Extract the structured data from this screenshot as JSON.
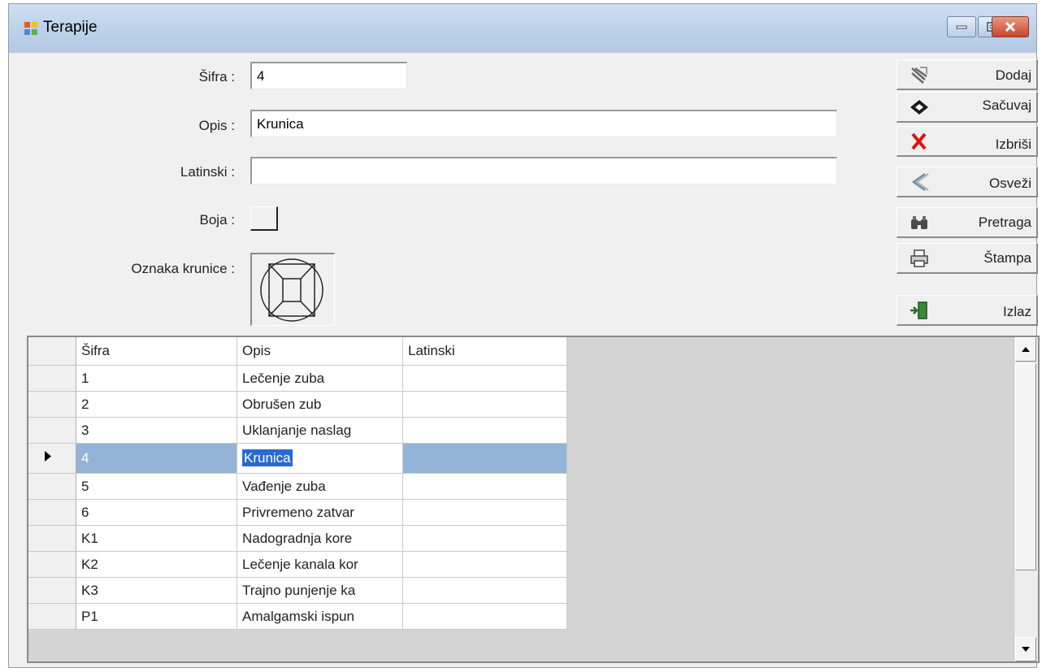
{
  "window": {
    "title": "Terapije"
  },
  "form": {
    "sifra_label": "Šifra :",
    "sifra_value": "4",
    "opis_label": "Opis :",
    "opis_value": "Krunica",
    "latinski_label": "Latinski :",
    "latinski_value": "",
    "boja_label": "Boja :",
    "oznaka_label": "Oznaka krunice :"
  },
  "toolbar": {
    "add_label": "Dodaj",
    "save_label": "Sačuvaj",
    "delete_label": "Izbriši",
    "refresh_label": "Osveži",
    "search_label": "Pretraga",
    "print_label": "Štampa",
    "exit_label": "Izlaz"
  },
  "grid": {
    "columns": [
      "Šifra",
      "Opis",
      "Latinski"
    ],
    "rows": [
      {
        "sifra": "1",
        "opis": "Lečenje zuba",
        "latinski": ""
      },
      {
        "sifra": "2",
        "opis": "Obrušen zub",
        "latinski": ""
      },
      {
        "sifra": "3",
        "opis": "Uklanjanje naslag",
        "latinski": ""
      },
      {
        "sifra": "4",
        "opis": "Krunica",
        "latinski": ""
      },
      {
        "sifra": "5",
        "opis": "Vađenje zuba",
        "latinski": ""
      },
      {
        "sifra": "6",
        "opis": "Privremeno zatvar",
        "latinski": ""
      },
      {
        "sifra": "K1",
        "opis": "Nadogradnja kore",
        "latinski": ""
      },
      {
        "sifra": "K2",
        "opis": "Lečenje kanala kor",
        "latinski": ""
      },
      {
        "sifra": "K3",
        "opis": "Trajno punjenje ka",
        "latinski": ""
      },
      {
        "sifra": "P1",
        "opis": "Amalgamski ispun",
        "latinski": ""
      }
    ],
    "selected_index": 3
  },
  "icons": {
    "add": "add-icon",
    "save": "save-icon",
    "delete": "delete-x-icon",
    "refresh": "refresh-arrows-icon",
    "search": "binoculars-icon",
    "print": "printer-icon",
    "exit": "exit-door-icon"
  },
  "colors": {
    "selection": "#93b4d7",
    "delete_red": "#e01010",
    "titlebar": "#c4d6ec"
  }
}
